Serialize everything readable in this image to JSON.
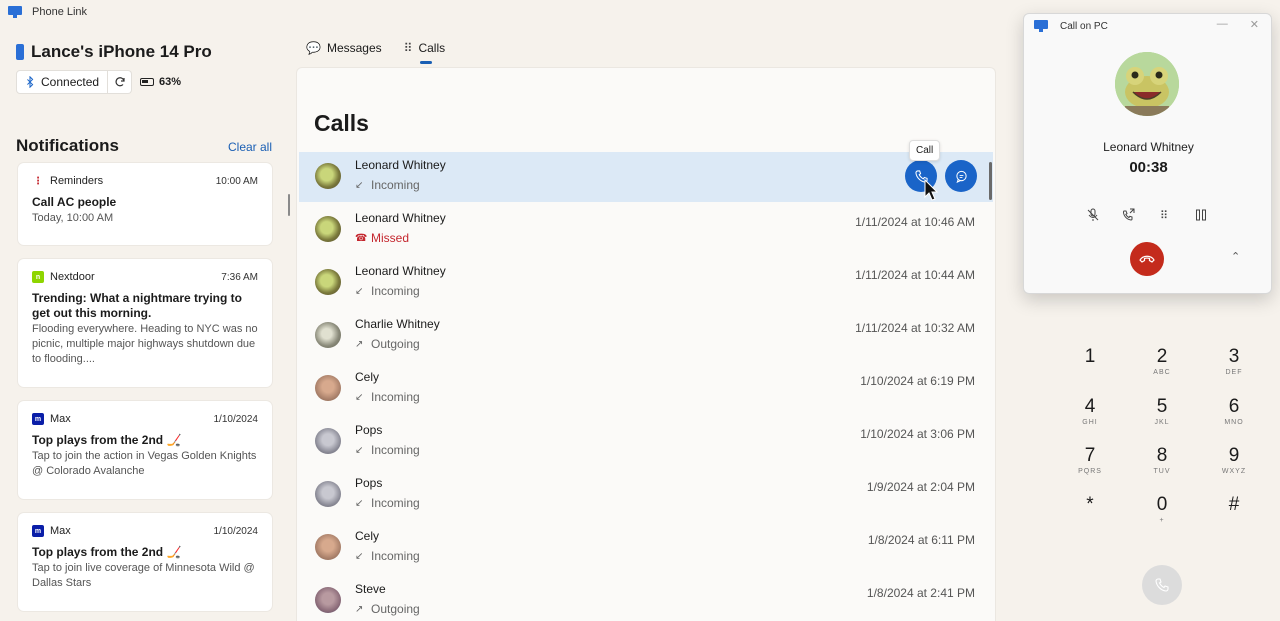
{
  "app": {
    "title": "Phone Link"
  },
  "device": {
    "name": "Lance's iPhone 14 Pro",
    "connection": "Connected",
    "battery": "63%"
  },
  "notifications": {
    "title": "Notifications",
    "clear_all": "Clear all",
    "items": [
      {
        "app": "Reminders",
        "time": "10:00 AM",
        "title": "Call AC people",
        "body": "Today, 10:00 AM",
        "icon": "reminders-icon",
        "color": "#c4262e"
      },
      {
        "app": "Nextdoor",
        "time": "7:36 AM",
        "title": "Trending: What a nightmare trying to get out  this morning.",
        "body": "Flooding everywhere. Heading to NYC was no picnic, multiple major highways shutdown due to flooding....",
        "icon": "nextdoor-icon",
        "color": "#8ed500"
      },
      {
        "app": "Max",
        "time": "1/10/2024",
        "title": "Top plays from the 2nd 🏒",
        "body": "Tap to join the action in Vegas Golden Knights @ Colorado Avalanche",
        "icon": "max-icon",
        "color": "#0a1ea8"
      },
      {
        "app": "Max",
        "time": "1/10/2024",
        "title": "Top plays from the 2nd 🏒",
        "body": "Tap to join live coverage of Minnesota Wild @ Dallas Stars",
        "icon": "max-icon",
        "color": "#0a1ea8"
      }
    ]
  },
  "tabs": [
    {
      "label": "Messages",
      "icon": "messages-icon",
      "active": false
    },
    {
      "label": "Calls",
      "icon": "dialpad-icon",
      "active": true
    }
  ],
  "calls": {
    "title": "Calls",
    "tooltip": "Call",
    "rows": [
      {
        "name": "Leonard Whitney",
        "type": "Incoming",
        "date": ""
      },
      {
        "name": "Leonard Whitney",
        "type": "Missed",
        "date": "1/11/2024 at 10:46 AM"
      },
      {
        "name": "Leonard Whitney",
        "type": "Incoming",
        "date": "1/11/2024 at 10:44 AM"
      },
      {
        "name": "Charlie Whitney",
        "type": "Outgoing",
        "date": "1/11/2024 at 10:32 AM"
      },
      {
        "name": "Cely",
        "type": "Incoming",
        "date": "1/10/2024 at 6:19 PM"
      },
      {
        "name": "Pops",
        "type": "Incoming",
        "date": "1/10/2024 at 3:06 PM"
      },
      {
        "name": "Pops",
        "type": "Incoming",
        "date": "1/9/2024 at 2:04 PM"
      },
      {
        "name": "Cely",
        "type": "Incoming",
        "date": "1/8/2024 at 6:11 PM"
      },
      {
        "name": "Steve",
        "type": "Outgoing",
        "date": "1/8/2024 at 2:41 PM"
      }
    ]
  },
  "dialpad": {
    "keys": [
      {
        "num": "1",
        "letters": ""
      },
      {
        "num": "2",
        "letters": "ABC"
      },
      {
        "num": "3",
        "letters": "DEF"
      },
      {
        "num": "4",
        "letters": "GHI"
      },
      {
        "num": "5",
        "letters": "JKL"
      },
      {
        "num": "6",
        "letters": "MNO"
      },
      {
        "num": "7",
        "letters": "PQRS"
      },
      {
        "num": "8",
        "letters": "TUV"
      },
      {
        "num": "9",
        "letters": "WXYZ"
      },
      {
        "num": "*",
        "letters": ""
      },
      {
        "num": "0",
        "letters": "+"
      },
      {
        "num": "#",
        "letters": ""
      }
    ]
  },
  "call_window": {
    "title": "Call on PC",
    "caller": "Leonard Whitney",
    "duration": "00:38"
  },
  "colors": {
    "accent": "#1a64c8",
    "hangup": "#c42b1c",
    "selected_row": "#dce9f6",
    "missed": "#c4262e"
  }
}
